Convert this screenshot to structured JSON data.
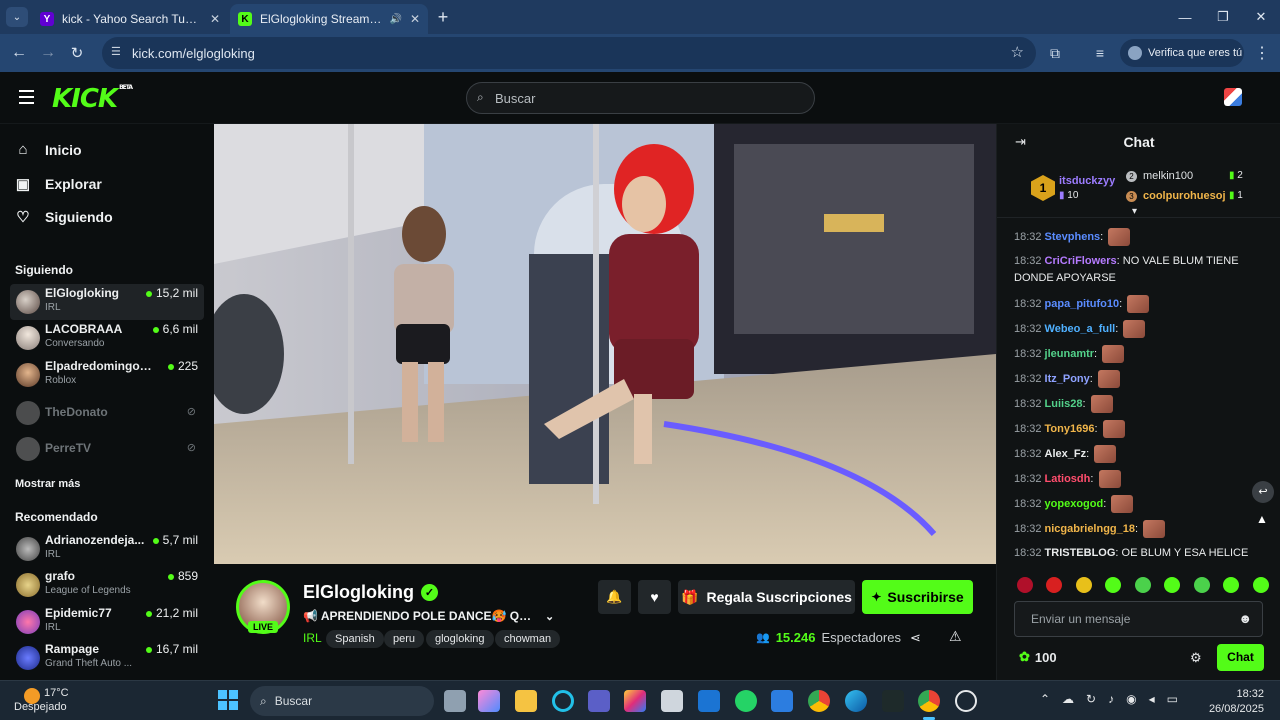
{
  "browser": {
    "tabs": [
      {
        "title": "kick - Yahoo Search Tus resultados",
        "favicon": "yahoo-icon"
      },
      {
        "title": "ElGlogloking Stream - Watch",
        "favicon": "kick-icon"
      }
    ],
    "url": "kick.com/elglogloking",
    "verify_label": "Verifica que eres tú"
  },
  "header": {
    "logo": "KICK",
    "logo_badge": "BETA",
    "search_placeholder": "Buscar"
  },
  "sidebar": {
    "nav": [
      {
        "label": "Inicio",
        "icon": "home-icon"
      },
      {
        "label": "Explorar",
        "icon": "browse-icon"
      },
      {
        "label": "Siguiendo",
        "icon": "heart-icon"
      }
    ],
    "following_heading": "Siguiendo",
    "following": [
      {
        "name": "ElGlogloking",
        "category": "IRL",
        "viewers": "15,2 mil",
        "live": true
      },
      {
        "name": "LACOBRAAA",
        "category": "Conversando",
        "viewers": "6,6 mil",
        "live": true
      },
      {
        "name": "ElpadredomingoOf...",
        "category": "Roblox",
        "viewers": "225",
        "live": true
      },
      {
        "name": "TheDonato",
        "live": false
      },
      {
        "name": "PerreTV",
        "live": false
      }
    ],
    "show_more": "Mostrar más",
    "recommended_heading": "Recomendado",
    "recommended": [
      {
        "name": "Adrianozendeja...",
        "category": "IRL",
        "viewers": "5,7 mil"
      },
      {
        "name": "grafo",
        "category": "League of Legends",
        "viewers": "859"
      },
      {
        "name": "Epidemic77",
        "category": "IRL",
        "viewers": "21,2 mil"
      },
      {
        "name": "Rampage",
        "category": "Grand Theft Auto ...",
        "viewers": "16,7 mil"
      }
    ]
  },
  "stream": {
    "channel": "ElGlogloking",
    "live_badge": "LIVE",
    "title": "📢 APRENDIENDO POLE DANCE🥵 QUE...",
    "category": "IRL",
    "tags": [
      "Spanish",
      "peru",
      "glogloking",
      "chowman"
    ],
    "gift_label": "Regala Suscripciones",
    "subscribe_label": "Suscribirse",
    "viewers": "15.246",
    "viewers_label": "Espectadores"
  },
  "chat": {
    "title": "Chat",
    "leaderboard": {
      "first": {
        "rank": "1",
        "name": "itsduckzyy",
        "score": "10"
      },
      "second": {
        "rank": "2",
        "name": "melkin100",
        "score": "2"
      },
      "third": {
        "rank": "3",
        "name": "coolpurohuesoj",
        "score": "1"
      }
    },
    "messages": [
      {
        "time": "18:32",
        "user": "Stevphens",
        "color": "#5a8cff",
        "text": "",
        "emote": true
      },
      {
        "time": "18:32",
        "user": "CriCriFlowers",
        "color": "#b57bff",
        "text": "NO VALE BLUM TIENE DONDE APOYARSE",
        "emote": false
      },
      {
        "time": "18:32",
        "user": "papa_pitufo10",
        "color": "#5a8cff",
        "text": "",
        "emote": true
      },
      {
        "time": "18:32",
        "user": "Webeo_a_full",
        "color": "#4fb0ff",
        "text": "",
        "emote": true
      },
      {
        "time": "18:32",
        "user": "jleunamtr",
        "color": "#53d18a",
        "text": "",
        "emote": true
      },
      {
        "time": "18:32",
        "user": "Itz_Pony",
        "color": "#8ea2ff",
        "text": "",
        "emote": true
      },
      {
        "time": "18:32",
        "user": "Luiis28",
        "color": "#53d18a",
        "text": "",
        "emote": true
      },
      {
        "time": "18:32",
        "user": "Tony1696",
        "color": "#f0b54a",
        "text": "",
        "emote": true
      },
      {
        "time": "18:32",
        "user": "Alex_Fz",
        "color": "#e9ebec",
        "text": "",
        "emote": true
      },
      {
        "time": "18:32",
        "user": "Latiosdh",
        "color": "#ff4d6d",
        "text": "",
        "emote": true
      },
      {
        "time": "18:32",
        "user": "yopexogod",
        "color": "#53fc18",
        "text": "",
        "emote": true
      },
      {
        "time": "18:32",
        "user": "nicgabrielngg_18",
        "color": "#f0b54a",
        "text": "",
        "emote": true
      },
      {
        "time": "18:32",
        "user": "TRISTEBLOG",
        "color": "#e9ebec",
        "text": "OE BLUM Y ESA HELICE",
        "emote": false
      }
    ],
    "input_placeholder": "Enviar un mensaje",
    "points": "100",
    "send_label": "Chat"
  },
  "taskbar": {
    "weather_temp": "17°C",
    "weather_desc": "Despejado",
    "search_label": "Buscar",
    "time": "18:32",
    "date": "26/08/2025"
  }
}
